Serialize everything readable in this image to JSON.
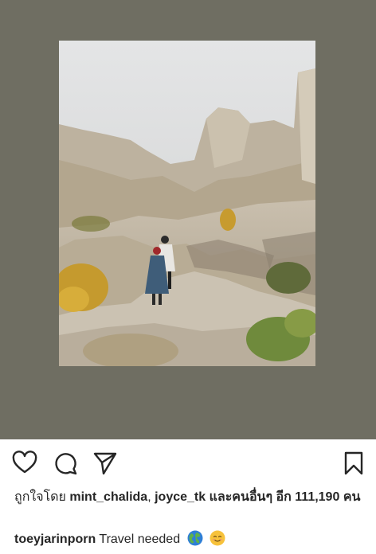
{
  "post": {
    "liked_by_prefix": "ถูกใจโดย",
    "liked_by_users": [
      "mint_chalida",
      "joyce_tk"
    ],
    "liked_by_separator": ",",
    "liked_by_others_prefix": "และคนอื่นๆ อีก",
    "liked_by_count": "111,190",
    "liked_by_count_unit": "คน",
    "author": "toeyjarinporn",
    "caption_text": "Travel needed",
    "caption_emojis": [
      "globe-emoji",
      "smiling-emoji"
    ]
  },
  "actions": {
    "like_icon": "heart-icon",
    "comment_icon": "comment-icon",
    "share_icon": "send-icon",
    "save_icon": "bookmark-icon"
  },
  "colors": {
    "media_background": "#6f6e62",
    "text": "#262626"
  }
}
